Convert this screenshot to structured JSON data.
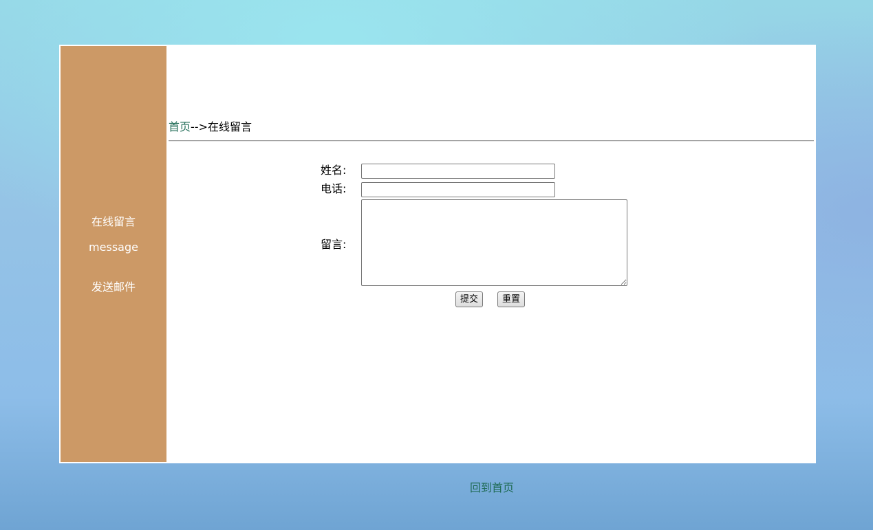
{
  "sidebar": {
    "items": [
      {
        "label": "在线留言"
      },
      {
        "label": "message"
      },
      {
        "label": "发送邮件"
      }
    ]
  },
  "breadcrumb": {
    "home": "首页",
    "separator": "-->",
    "current": "在线留言"
  },
  "form": {
    "name_label": "姓名:",
    "name_value": "",
    "phone_label": "电话:",
    "phone_value": "",
    "message_label": "留言:",
    "message_value": "",
    "submit_label": "提交",
    "reset_label": "重置"
  },
  "footer": {
    "back_home": "回到首页"
  },
  "colors": {
    "sidebar_bg": "#cc9966",
    "link": "#1f6b55",
    "frame_bg": "#ffffff"
  }
}
